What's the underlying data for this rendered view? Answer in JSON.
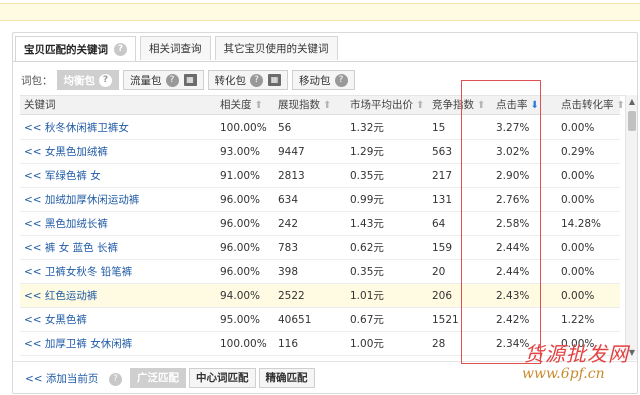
{
  "tabs": [
    {
      "label": "宝贝匹配的关键词",
      "active": true
    },
    {
      "label": "相关词查询",
      "active": false
    },
    {
      "label": "其它宝贝使用的关键词",
      "active": false
    }
  ],
  "help_icon": "?",
  "packages": {
    "label": "词包：",
    "items": [
      {
        "label": "均衡包",
        "active": true,
        "icon": "help-icon"
      },
      {
        "label": "流量包",
        "active": false,
        "icon": "table-icon"
      },
      {
        "label": "转化包",
        "active": false,
        "icon": "table-icon"
      },
      {
        "label": "移动包",
        "active": false,
        "icon": "help-icon"
      }
    ]
  },
  "sort_icon": "⬆",
  "sort_active_icon": "⬇",
  "columns": [
    {
      "label": "关键词",
      "sort": false,
      "active": false
    },
    {
      "label": "相关度",
      "sort": true,
      "active": false
    },
    {
      "label": "展现指数",
      "sort": true,
      "active": false
    },
    {
      "label": "市场平均出价",
      "sort": true,
      "active": false
    },
    {
      "label": "竞争指数",
      "sort": true,
      "active": false
    },
    {
      "label": "点击率",
      "sort": true,
      "active": true
    },
    {
      "label": "点击转化率",
      "sort": true,
      "active": false
    }
  ],
  "rows": [
    {
      "kw": "<< 秋冬休闲裤卫裤女",
      "rel": "100.00%",
      "impr": "56",
      "bid": "1.32元",
      "comp": "15",
      "ctr": "3.27%",
      "cvr": "0.00%",
      "highlight": false
    },
    {
      "kw": "<< 女黑色加绒裤",
      "rel": "93.00%",
      "impr": "9447",
      "bid": "1.29元",
      "comp": "563",
      "ctr": "3.02%",
      "cvr": "0.29%",
      "highlight": false
    },
    {
      "kw": "<< 军绿色裤 女",
      "rel": "91.00%",
      "impr": "2813",
      "bid": "0.35元",
      "comp": "217",
      "ctr": "2.90%",
      "cvr": "0.00%",
      "highlight": false
    },
    {
      "kw": "<< 加绒加厚休闲运动裤",
      "rel": "96.00%",
      "impr": "634",
      "bid": "0.99元",
      "comp": "131",
      "ctr": "2.76%",
      "cvr": "0.00%",
      "highlight": false
    },
    {
      "kw": "<< 黑色加绒长裤",
      "rel": "96.00%",
      "impr": "242",
      "bid": "1.43元",
      "comp": "64",
      "ctr": "2.58%",
      "cvr": "14.28%",
      "highlight": false
    },
    {
      "kw": "<< 裤 女 蓝色 长裤",
      "rel": "96.00%",
      "impr": "783",
      "bid": "0.62元",
      "comp": "159",
      "ctr": "2.44%",
      "cvr": "0.00%",
      "highlight": false
    },
    {
      "kw": "<< 卫裤女秋冬 铅笔裤",
      "rel": "96.00%",
      "impr": "398",
      "bid": "0.35元",
      "comp": "20",
      "ctr": "2.44%",
      "cvr": "0.00%",
      "highlight": false
    },
    {
      "kw": "<< 红色运动裤",
      "rel": "94.00%",
      "impr": "2522",
      "bid": "1.01元",
      "comp": "206",
      "ctr": "2.43%",
      "cvr": "0.00%",
      "highlight": true
    },
    {
      "kw": "<< 女黑色裤",
      "rel": "95.00%",
      "impr": "40651",
      "bid": "0.67元",
      "comp": "1521",
      "ctr": "2.42%",
      "cvr": "1.22%",
      "highlight": false
    },
    {
      "kw": "<< 加厚卫裤 女休闲裤",
      "rel": "100.00%",
      "impr": "116",
      "bid": "1.00元",
      "comp": "28",
      "ctr": "2.34%",
      "cvr": "0.00%",
      "highlight": false
    }
  ],
  "bottom": {
    "add_label": "<< 添加当前页",
    "match_buttons": [
      {
        "label": "广泛匹配",
        "active": true
      },
      {
        "label": "中心词匹配",
        "active": false
      },
      {
        "label": "精确匹配",
        "active": false
      }
    ]
  },
  "scroll": {
    "up": "▲",
    "down": "▼"
  },
  "watermark": {
    "title": "货源批发网",
    "url": "www.6pf.cn"
  },
  "colors": {
    "accent_red": "#e05050",
    "link_blue": "#1f5aa6",
    "sort_blue": "#2b7bd6",
    "highlight_row": "#fffbe3"
  }
}
